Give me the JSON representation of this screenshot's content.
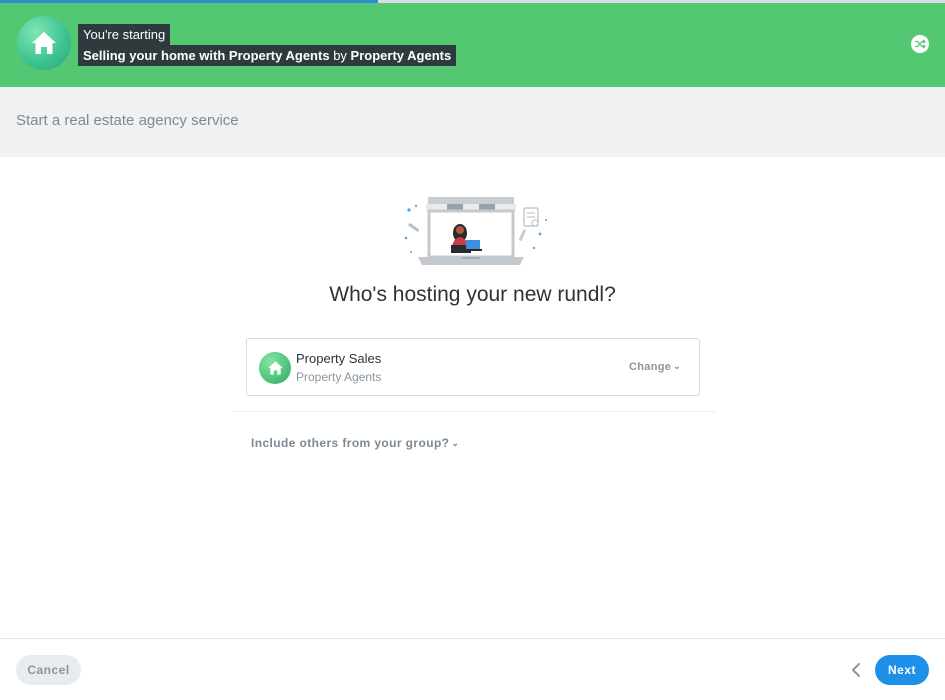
{
  "progress": {
    "fraction": 0.4,
    "fill_color": "#2b8fd6"
  },
  "banner": {
    "line1": "You're starting",
    "template_name": "Selling your home with Property Agents",
    "by_word": "by",
    "author": "Property Agents",
    "background": "#54c773",
    "avatar_icon": "house-icon",
    "action_icon": "shuffle-icon"
  },
  "subheader": {
    "title": "Start a real estate agency service"
  },
  "main": {
    "question": "Who's hosting your new rundl?",
    "illustration": "storefront-laptop-illustration",
    "host": {
      "name": "Property Sales",
      "group": "Property Agents",
      "change_label": "Change",
      "avatar_icon": "house-icon"
    },
    "include_label": "Include others from your group?"
  },
  "footer": {
    "cancel_label": "Cancel",
    "next_label": "Next",
    "back_icon": "chevron-left-icon",
    "accent": "#1e90e8"
  }
}
